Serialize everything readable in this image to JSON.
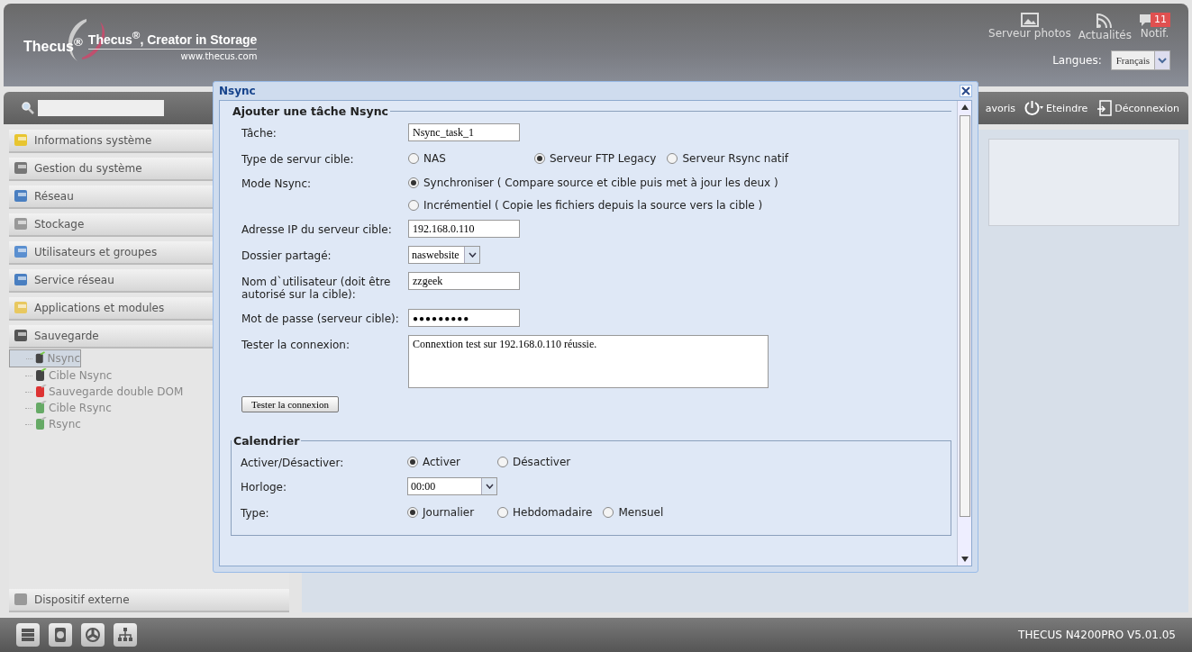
{
  "header": {
    "logo": "Thecus$^{®}$",
    "tagline": "Thecus$^{®}$, Creator in Storage",
    "url": "www.thecus.com",
    "links": [
      {
        "label": "Serveur photos",
        "kind": "photo"
      },
      {
        "label": "Actualités",
        "kind": "rss"
      },
      {
        "label": "Notif.",
        "kind": "notif",
        "badge": "11"
      }
    ],
    "language": {
      "label": "Langues:",
      "value": "Français"
    }
  },
  "toolbar": [
    {
      "label": "avoris",
      "kind": "plain"
    },
    {
      "label": "Eteindre",
      "kind": "power"
    },
    {
      "label": "Déconnexion",
      "kind": "logout"
    }
  ],
  "sidebar": {
    "groups": [
      {
        "label": "Informations système",
        "kind": "info"
      },
      {
        "label": "Gestion du système",
        "kind": "tools"
      },
      {
        "label": "Réseau",
        "kind": "network"
      },
      {
        "label": "Stockage",
        "kind": "storage"
      },
      {
        "label": "Utilisateurs et groupes",
        "kind": "users"
      },
      {
        "label": "Service réseau",
        "kind": "network"
      },
      {
        "label": "Applications et modules",
        "kind": "folder"
      },
      {
        "label": "Sauvegarde",
        "kind": "disk",
        "children": [
          {
            "label": "Nsync",
            "kind": "nsync",
            "selected": true
          },
          {
            "label": "Cible Nsync",
            "kind": "nsync",
            "selected": false
          },
          {
            "label": "Sauvegarde double DOM",
            "kind": "shield",
            "selected": false
          },
          {
            "label": "Cible Rsync",
            "kind": "sync",
            "selected": false
          },
          {
            "label": "Rsync",
            "kind": "sync",
            "selected": false
          }
        ]
      }
    ],
    "bottom_group": {
      "label": "Dispositif externe",
      "kind": "storage"
    }
  },
  "dialog": {
    "title": "Nsync",
    "sections": [
      {
        "legend": "Ajouter une tâche Nsync",
        "rows": [
          {
            "kind": "text",
            "label": "Tâche:",
            "value": "Nsync_task_1"
          },
          {
            "kind": "radio",
            "label": "Type de servur cible:",
            "options": [
              {
                "label": "NAS",
                "selected": false
              },
              {
                "label": "Serveur FTP Legacy",
                "selected": true
              },
              {
                "label": "Serveur Rsync natif",
                "selected": false
              }
            ]
          },
          {
            "kind": "radiocol",
            "label": "Mode Nsync:",
            "options": [
              {
                "label": "Synchroniser ( Compare source et cible puis met à jour les deux )",
                "selected": true
              },
              {
                "label": "Incrémentiel ( Copie les fichiers depuis la source vers la cible )",
                "selected": false
              }
            ]
          },
          {
            "kind": "text",
            "label": "Adresse IP du serveur cible:",
            "value": "192.168.0.110"
          },
          {
            "kind": "select",
            "label": "Dossier partagé:",
            "value": "naswebsite"
          },
          {
            "kind": "text",
            "label": "Nom d`utilisateur (doit être autorisé sur la cible):",
            "value": "zzgeek"
          },
          {
            "kind": "password",
            "label": "Mot de passe (serveur cible):",
            "value": "●●●●●●●●●"
          },
          {
            "kind": "textarea",
            "label": "Tester la connexion:",
            "value": "Connextion test sur 192.168.0.110 réussie."
          },
          {
            "kind": "button",
            "label": "Tester la connexion"
          }
        ]
      },
      {
        "legend": "Calendrier",
        "rows": [
          {
            "kind": "radio",
            "label": "Activer/Désactiver:",
            "options": [
              {
                "label": "Activer",
                "selected": true
              },
              {
                "label": "Désactiver",
                "selected": false
              }
            ]
          },
          {
            "kind": "select",
            "label": "Horloge:",
            "value": "00:00"
          },
          {
            "kind": "radio",
            "label": "Type:",
            "options": [
              {
                "label": "Journalier",
                "selected": true
              },
              {
                "label": "Hebdomadaire",
                "selected": false
              },
              {
                "label": "Mensuel",
                "selected": false
              }
            ]
          }
        ]
      }
    ]
  },
  "status_bar": {
    "version": "THECUS N4200PRO V5.01.05"
  }
}
